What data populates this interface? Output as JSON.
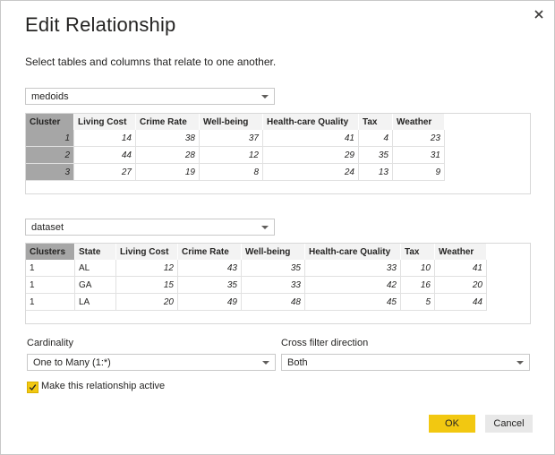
{
  "dialog": {
    "title": "Edit Relationship",
    "subtitle": "Select tables and columns that relate to one another.",
    "close_icon": "close-icon"
  },
  "table1": {
    "selected": "medoids",
    "columns": [
      "Cluster",
      "Living Cost",
      "Crime Rate",
      "Well-being",
      "Health-care Quality",
      "Tax",
      "Weather"
    ],
    "rows": [
      [
        "1",
        "14",
        "38",
        "37",
        "41",
        "4",
        "23"
      ],
      [
        "2",
        "44",
        "28",
        "12",
        "29",
        "35",
        "31"
      ],
      [
        "3",
        "27",
        "19",
        "8",
        "24",
        "13",
        "9"
      ]
    ]
  },
  "table2": {
    "selected": "dataset",
    "columns": [
      "Clusters",
      "State",
      "Living Cost",
      "Crime Rate",
      "Well-being",
      "Health-care Quality",
      "Tax",
      "Weather"
    ],
    "rows": [
      [
        "1",
        "AL",
        "12",
        "43",
        "35",
        "33",
        "10",
        "41"
      ],
      [
        "1",
        "GA",
        "15",
        "35",
        "33",
        "42",
        "16",
        "20"
      ],
      [
        "1",
        "LA",
        "20",
        "49",
        "48",
        "45",
        "5",
        "44"
      ]
    ]
  },
  "cardinality": {
    "label": "Cardinality",
    "value": "One to Many (1:*)"
  },
  "cross_filter": {
    "label": "Cross filter direction",
    "value": "Both"
  },
  "active_checkbox": {
    "label": "Make this relationship active",
    "checked": true
  },
  "buttons": {
    "ok": "OK",
    "cancel": "Cancel"
  },
  "colors": {
    "accent": "#f2c811",
    "selected_column": "#a6a6a6",
    "header_bg": "#f3f3f3"
  }
}
